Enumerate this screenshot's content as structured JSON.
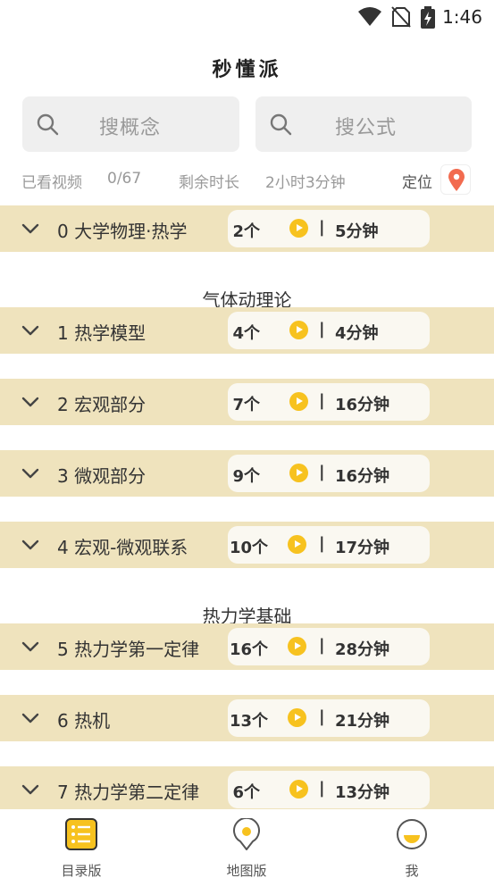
{
  "status_bar": {
    "time": "1:46",
    "icons": [
      "wifi-icon",
      "no-sim-icon",
      "battery-charging-icon"
    ]
  },
  "app_title": "秒懂派",
  "search": {
    "concept_placeholder": "搜概念",
    "formula_placeholder": "搜公式"
  },
  "stats": {
    "watched_label": "已看视频",
    "watched_value": "0/67",
    "remaining_label": "剩余时长",
    "remaining_value": "2小时3分钟",
    "locate_label": "定位"
  },
  "sections": [
    {
      "header": "",
      "chapters": [
        {
          "title": "0 大学物理·热学",
          "count": "2个",
          "duration": "5分钟"
        }
      ]
    },
    {
      "header": "气体动理论",
      "chapters": [
        {
          "title": "1 热学模型",
          "count": "4个",
          "duration": "4分钟"
        },
        {
          "title": "2 宏观部分",
          "count": "7个",
          "duration": "16分钟"
        },
        {
          "title": "3 微观部分",
          "count": "9个",
          "duration": "16分钟"
        },
        {
          "title": "4 宏观-微观联系",
          "count": "10个",
          "duration": "17分钟"
        }
      ]
    },
    {
      "header": "热力学基础",
      "chapters": [
        {
          "title": "5 热力学第一定律",
          "count": "16个",
          "duration": "28分钟"
        },
        {
          "title": "6 热机",
          "count": "13个",
          "duration": "21分钟"
        },
        {
          "title": "7 热力学第二定律",
          "count": "6个",
          "duration": "13分钟"
        }
      ]
    }
  ],
  "pill_separator": "|",
  "bottom_nav": [
    {
      "label": "目录版",
      "icon": "list-icon",
      "active": true
    },
    {
      "label": "地图版",
      "icon": "map-pin-icon",
      "active": false
    },
    {
      "label": "我",
      "icon": "profile-icon",
      "active": false
    }
  ],
  "colors": {
    "accent": "#f7c21f",
    "row_bg": "#efe3bd",
    "pill_bg": "#faf8f1",
    "locate": "#f26b4f"
  }
}
